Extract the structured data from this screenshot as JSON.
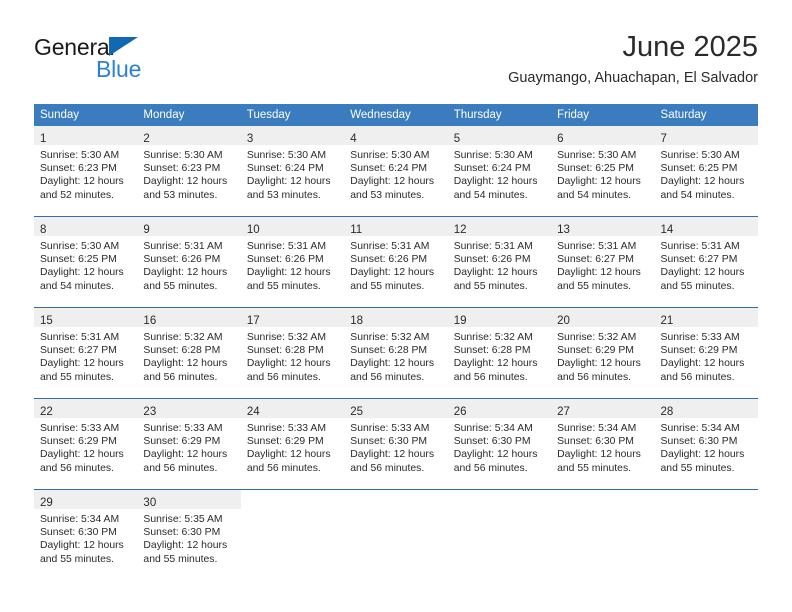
{
  "branding": {
    "name_top": "General",
    "name_bottom": "Blue",
    "triangle_color": "#1268b3",
    "blue_color": "#2b82d4"
  },
  "header": {
    "title": "June 2025",
    "subtitle": "Guaymango, Ahuachapan, El Salvador"
  },
  "theme": {
    "header_bg": "#3a7cbe",
    "row_divider": "#2f6fb0",
    "daynum_band": "#efefef"
  },
  "weekday_headers": [
    "Sunday",
    "Monday",
    "Tuesday",
    "Wednesday",
    "Thursday",
    "Friday",
    "Saturday"
  ],
  "weeks": [
    [
      {
        "day": "1",
        "sunrise": "Sunrise: 5:30 AM",
        "sunset": "Sunset: 6:23 PM",
        "daylight1": "Daylight: 12 hours",
        "daylight2": "and 52 minutes."
      },
      {
        "day": "2",
        "sunrise": "Sunrise: 5:30 AM",
        "sunset": "Sunset: 6:23 PM",
        "daylight1": "Daylight: 12 hours",
        "daylight2": "and 53 minutes."
      },
      {
        "day": "3",
        "sunrise": "Sunrise: 5:30 AM",
        "sunset": "Sunset: 6:24 PM",
        "daylight1": "Daylight: 12 hours",
        "daylight2": "and 53 minutes."
      },
      {
        "day": "4",
        "sunrise": "Sunrise: 5:30 AM",
        "sunset": "Sunset: 6:24 PM",
        "daylight1": "Daylight: 12 hours",
        "daylight2": "and 53 minutes."
      },
      {
        "day": "5",
        "sunrise": "Sunrise: 5:30 AM",
        "sunset": "Sunset: 6:24 PM",
        "daylight1": "Daylight: 12 hours",
        "daylight2": "and 54 minutes."
      },
      {
        "day": "6",
        "sunrise": "Sunrise: 5:30 AM",
        "sunset": "Sunset: 6:25 PM",
        "daylight1": "Daylight: 12 hours",
        "daylight2": "and 54 minutes."
      },
      {
        "day": "7",
        "sunrise": "Sunrise: 5:30 AM",
        "sunset": "Sunset: 6:25 PM",
        "daylight1": "Daylight: 12 hours",
        "daylight2": "and 54 minutes."
      }
    ],
    [
      {
        "day": "8",
        "sunrise": "Sunrise: 5:30 AM",
        "sunset": "Sunset: 6:25 PM",
        "daylight1": "Daylight: 12 hours",
        "daylight2": "and 54 minutes."
      },
      {
        "day": "9",
        "sunrise": "Sunrise: 5:31 AM",
        "sunset": "Sunset: 6:26 PM",
        "daylight1": "Daylight: 12 hours",
        "daylight2": "and 55 minutes."
      },
      {
        "day": "10",
        "sunrise": "Sunrise: 5:31 AM",
        "sunset": "Sunset: 6:26 PM",
        "daylight1": "Daylight: 12 hours",
        "daylight2": "and 55 minutes."
      },
      {
        "day": "11",
        "sunrise": "Sunrise: 5:31 AM",
        "sunset": "Sunset: 6:26 PM",
        "daylight1": "Daylight: 12 hours",
        "daylight2": "and 55 minutes."
      },
      {
        "day": "12",
        "sunrise": "Sunrise: 5:31 AM",
        "sunset": "Sunset: 6:26 PM",
        "daylight1": "Daylight: 12 hours",
        "daylight2": "and 55 minutes."
      },
      {
        "day": "13",
        "sunrise": "Sunrise: 5:31 AM",
        "sunset": "Sunset: 6:27 PM",
        "daylight1": "Daylight: 12 hours",
        "daylight2": "and 55 minutes."
      },
      {
        "day": "14",
        "sunrise": "Sunrise: 5:31 AM",
        "sunset": "Sunset: 6:27 PM",
        "daylight1": "Daylight: 12 hours",
        "daylight2": "and 55 minutes."
      }
    ],
    [
      {
        "day": "15",
        "sunrise": "Sunrise: 5:31 AM",
        "sunset": "Sunset: 6:27 PM",
        "daylight1": "Daylight: 12 hours",
        "daylight2": "and 55 minutes."
      },
      {
        "day": "16",
        "sunrise": "Sunrise: 5:32 AM",
        "sunset": "Sunset: 6:28 PM",
        "daylight1": "Daylight: 12 hours",
        "daylight2": "and 56 minutes."
      },
      {
        "day": "17",
        "sunrise": "Sunrise: 5:32 AM",
        "sunset": "Sunset: 6:28 PM",
        "daylight1": "Daylight: 12 hours",
        "daylight2": "and 56 minutes."
      },
      {
        "day": "18",
        "sunrise": "Sunrise: 5:32 AM",
        "sunset": "Sunset: 6:28 PM",
        "daylight1": "Daylight: 12 hours",
        "daylight2": "and 56 minutes."
      },
      {
        "day": "19",
        "sunrise": "Sunrise: 5:32 AM",
        "sunset": "Sunset: 6:28 PM",
        "daylight1": "Daylight: 12 hours",
        "daylight2": "and 56 minutes."
      },
      {
        "day": "20",
        "sunrise": "Sunrise: 5:32 AM",
        "sunset": "Sunset: 6:29 PM",
        "daylight1": "Daylight: 12 hours",
        "daylight2": "and 56 minutes."
      },
      {
        "day": "21",
        "sunrise": "Sunrise: 5:33 AM",
        "sunset": "Sunset: 6:29 PM",
        "daylight1": "Daylight: 12 hours",
        "daylight2": "and 56 minutes."
      }
    ],
    [
      {
        "day": "22",
        "sunrise": "Sunrise: 5:33 AM",
        "sunset": "Sunset: 6:29 PM",
        "daylight1": "Daylight: 12 hours",
        "daylight2": "and 56 minutes."
      },
      {
        "day": "23",
        "sunrise": "Sunrise: 5:33 AM",
        "sunset": "Sunset: 6:29 PM",
        "daylight1": "Daylight: 12 hours",
        "daylight2": "and 56 minutes."
      },
      {
        "day": "24",
        "sunrise": "Sunrise: 5:33 AM",
        "sunset": "Sunset: 6:29 PM",
        "daylight1": "Daylight: 12 hours",
        "daylight2": "and 56 minutes."
      },
      {
        "day": "25",
        "sunrise": "Sunrise: 5:33 AM",
        "sunset": "Sunset: 6:30 PM",
        "daylight1": "Daylight: 12 hours",
        "daylight2": "and 56 minutes."
      },
      {
        "day": "26",
        "sunrise": "Sunrise: 5:34 AM",
        "sunset": "Sunset: 6:30 PM",
        "daylight1": "Daylight: 12 hours",
        "daylight2": "and 56 minutes."
      },
      {
        "day": "27",
        "sunrise": "Sunrise: 5:34 AM",
        "sunset": "Sunset: 6:30 PM",
        "daylight1": "Daylight: 12 hours",
        "daylight2": "and 55 minutes."
      },
      {
        "day": "28",
        "sunrise": "Sunrise: 5:34 AM",
        "sunset": "Sunset: 6:30 PM",
        "daylight1": "Daylight: 12 hours",
        "daylight2": "and 55 minutes."
      }
    ],
    [
      {
        "day": "29",
        "sunrise": "Sunrise: 5:34 AM",
        "sunset": "Sunset: 6:30 PM",
        "daylight1": "Daylight: 12 hours",
        "daylight2": "and 55 minutes."
      },
      {
        "day": "30",
        "sunrise": "Sunrise: 5:35 AM",
        "sunset": "Sunset: 6:30 PM",
        "daylight1": "Daylight: 12 hours",
        "daylight2": "and 55 minutes."
      },
      {
        "day": "",
        "sunrise": "",
        "sunset": "",
        "daylight1": "",
        "daylight2": ""
      },
      {
        "day": "",
        "sunrise": "",
        "sunset": "",
        "daylight1": "",
        "daylight2": ""
      },
      {
        "day": "",
        "sunrise": "",
        "sunset": "",
        "daylight1": "",
        "daylight2": ""
      },
      {
        "day": "",
        "sunrise": "",
        "sunset": "",
        "daylight1": "",
        "daylight2": ""
      },
      {
        "day": "",
        "sunrise": "",
        "sunset": "",
        "daylight1": "",
        "daylight2": ""
      }
    ]
  ]
}
